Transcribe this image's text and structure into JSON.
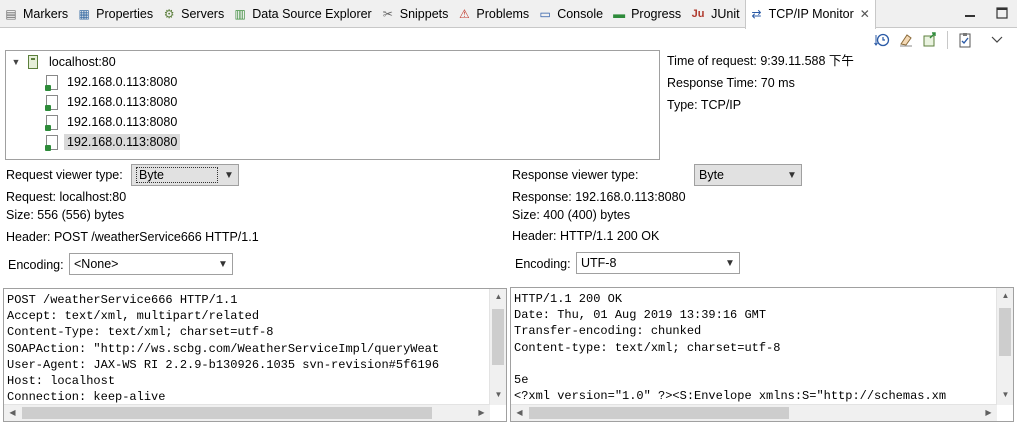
{
  "tabs": [
    {
      "label": "Markers",
      "icon": "markers-icon",
      "glyph": "▤"
    },
    {
      "label": "Properties",
      "icon": "properties-icon",
      "glyph": "▦"
    },
    {
      "label": "Servers",
      "icon": "servers-icon",
      "glyph": "⚙"
    },
    {
      "label": "Data Source Explorer",
      "icon": "data-source-icon",
      "glyph": "▥"
    },
    {
      "label": "Snippets",
      "icon": "snippets-icon",
      "glyph": "✂"
    },
    {
      "label": "Problems",
      "icon": "problems-icon",
      "glyph": "⚠"
    },
    {
      "label": "Console",
      "icon": "console-icon",
      "glyph": "▭"
    },
    {
      "label": "Progress",
      "icon": "progress-icon",
      "glyph": "▬"
    },
    {
      "label": "JUnit",
      "icon": "junit-icon",
      "glyph": "Ju"
    },
    {
      "label": "TCP/IP Monitor",
      "icon": "tcpip-monitor-icon",
      "glyph": "⇄",
      "active": true
    }
  ],
  "tree": {
    "root": "localhost:80",
    "children": [
      "192.168.0.113:8080",
      "192.168.0.113:8080",
      "192.168.0.113:8080",
      "192.168.0.113:8080"
    ],
    "selected_index": 3
  },
  "info": {
    "time_of_request": "Time of request: 9:39.11.588 下午",
    "response_time": "Response Time: 70 ms",
    "type": "Type: TCP/IP"
  },
  "request": {
    "viewer_label": "Request viewer type:",
    "viewer_value": "Byte",
    "request_line": "Request: localhost:80",
    "size": "Size: 556 (556) bytes",
    "header": "Header: POST /weatherService666 HTTP/1.1",
    "encoding_label": "Encoding:",
    "encoding_value": "<None>",
    "body": "POST /weatherService666 HTTP/1.1\nAccept: text/xml, multipart/related\nContent-Type: text/xml; charset=utf-8\nSOAPAction: \"http://ws.scbg.com/WeatherServiceImpl/queryWeat\nUser-Agent: JAX-WS RI 2.2.9-b130926.1035 svn-revision#5f6196\nHost: localhost\nConnection: keep-alive"
  },
  "response": {
    "viewer_label": "Response viewer type:",
    "viewer_value": "Byte",
    "response_line": "Response: 192.168.0.113:8080",
    "size": "Size: 400 (400) bytes",
    "header": "Header: HTTP/1.1 200 OK",
    "encoding_label": "Encoding:",
    "encoding_value": "UTF-8",
    "body": "HTTP/1.1 200 OK\nDate: Thu, 01 Aug 2019 13:39:16 GMT\nTransfer-encoding: chunked\nContent-type: text/xml; charset=utf-8\n\n5e\n<?xml version=\"1.0\" ?><S:Envelope xmlns:S=\"http://schemas.xm"
  }
}
